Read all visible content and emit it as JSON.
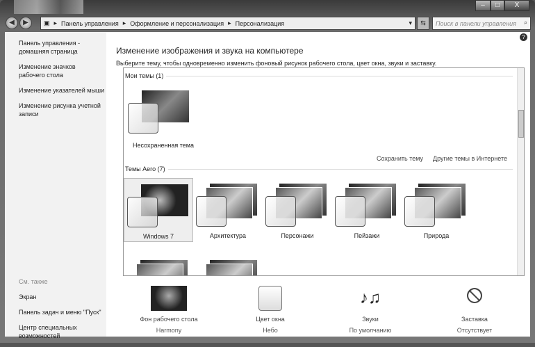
{
  "window": {
    "minimize": "‒",
    "maximize": "□",
    "close": "X"
  },
  "address": {
    "crumbs": [
      "Панель управления",
      "Оформление и персонализация",
      "Персонализация"
    ],
    "search_placeholder": "Поиск в панели управления"
  },
  "sidebar": {
    "links": [
      "Панель управления - домашняя страница",
      "Изменение значков рабочего стола",
      "Изменение указателей мыши",
      "Изменение рисунка учетной записи"
    ],
    "see_also": "См. также",
    "see_also_links": [
      "Экран",
      "Панель задач и меню \"Пуск\"",
      "Центр специальных возможностей"
    ]
  },
  "main": {
    "title": "Изменение изображения и звука на компьютере",
    "subtitle": "Выберите тему, чтобы одновременно изменить фоновый рисунок рабочего стола, цвет окна, звуки и заставку.",
    "my_themes": "Мои темы (1)",
    "unsaved": "Несохраненная тема",
    "save_theme": "Сохранить тему",
    "more_themes": "Другие темы в Интернете",
    "aero_themes": "Темы Aero (7)",
    "themes": [
      "Windows 7",
      "Архитектура",
      "Персонажи",
      "Пейзажи",
      "Природа"
    ],
    "help": "?"
  },
  "bottom": [
    {
      "label": "Фон рабочего стола",
      "value": "Harmony"
    },
    {
      "label": "Цвет окна",
      "value": "Небо"
    },
    {
      "label": "Звуки",
      "value": "По умолчанию"
    },
    {
      "label": "Заставка",
      "value": "Отсутствует"
    }
  ]
}
